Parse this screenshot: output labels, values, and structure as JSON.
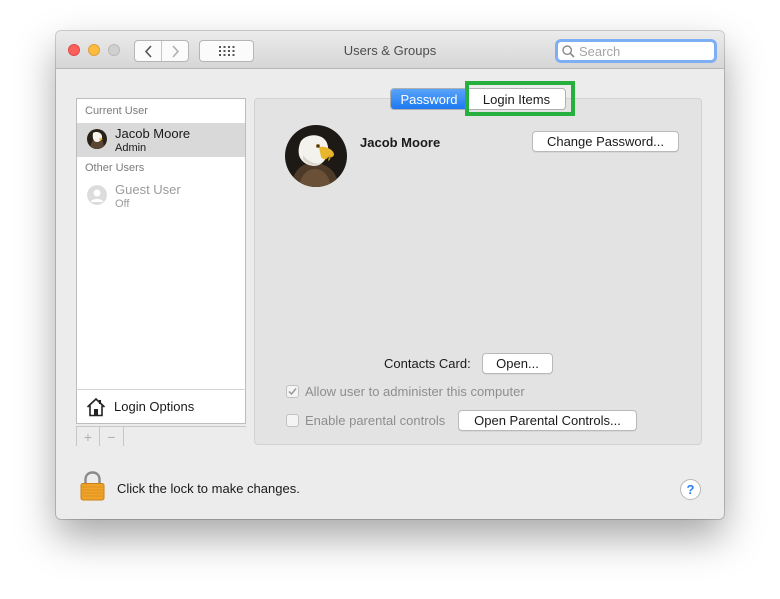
{
  "window": {
    "title": "Users & Groups",
    "search_placeholder": "Search"
  },
  "sidebar": {
    "current_user_heading": "Current User",
    "current_user": {
      "name": "Jacob Moore",
      "role": "Admin"
    },
    "other_users_heading": "Other Users",
    "other_users": [
      {
        "name": "Guest User",
        "status": "Off"
      }
    ],
    "login_options_label": "Login Options",
    "add_symbol": "+",
    "remove_symbol": "−"
  },
  "tabs": [
    {
      "label": "Password",
      "selected": true
    },
    {
      "label": "Login Items",
      "selected": false
    }
  ],
  "main": {
    "full_name": "Jacob Moore",
    "change_password_label": "Change Password...",
    "contacts_card_label": "Contacts Card:",
    "open_label": "Open...",
    "allow_admin_label": "Allow user to administer this computer",
    "allow_admin_checked": true,
    "parental_controls_label": "Enable parental controls",
    "parental_controls_checked": false,
    "open_parental_label": "Open Parental Controls..."
  },
  "footer": {
    "lock_text": "Click the lock to make changes.",
    "help_symbol": "?"
  },
  "colors": {
    "accent_blue": "#1c79f1",
    "highlight_green": "#27b03e",
    "close": "#fc605b",
    "minimize": "#fdbc40"
  },
  "icons": [
    "back-icon",
    "forward-icon",
    "grid-icon",
    "search-icon",
    "house-icon",
    "lock-icon",
    "help-icon",
    "checkmark-icon"
  ]
}
